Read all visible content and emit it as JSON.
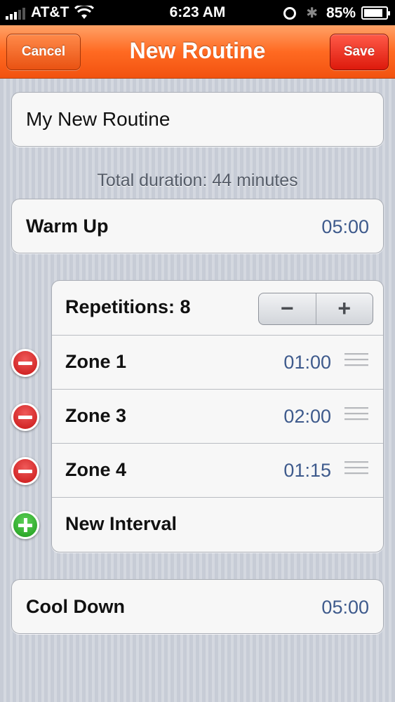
{
  "status_bar": {
    "carrier": "AT&T",
    "time": "6:23 AM",
    "battery": "85%",
    "battery_level": 0.85
  },
  "nav": {
    "title": "New Routine",
    "cancel_label": "Cancel",
    "save_label": "Save"
  },
  "routine": {
    "name": "My New Routine",
    "total_duration": "Total duration: 44 minutes"
  },
  "warm_up": {
    "label": "Warm Up",
    "time": "05:00"
  },
  "repetitions": {
    "label": "Repetitions: 8",
    "minus": "−",
    "plus": "+"
  },
  "intervals": [
    {
      "label": "Zone 1",
      "time": "01:00"
    },
    {
      "label": "Zone 3",
      "time": "02:00"
    },
    {
      "label": "Zone 4",
      "time": "01:15"
    }
  ],
  "new_interval": {
    "label": "New Interval"
  },
  "cool_down": {
    "label": "Cool Down",
    "time": "05:00"
  },
  "colors": {
    "nav_orange": "#ff6a22",
    "save_red": "#dd1a0c",
    "time_blue": "#3e5a8c",
    "delete_red": "#c81414",
    "add_green": "#1d9a1a"
  }
}
